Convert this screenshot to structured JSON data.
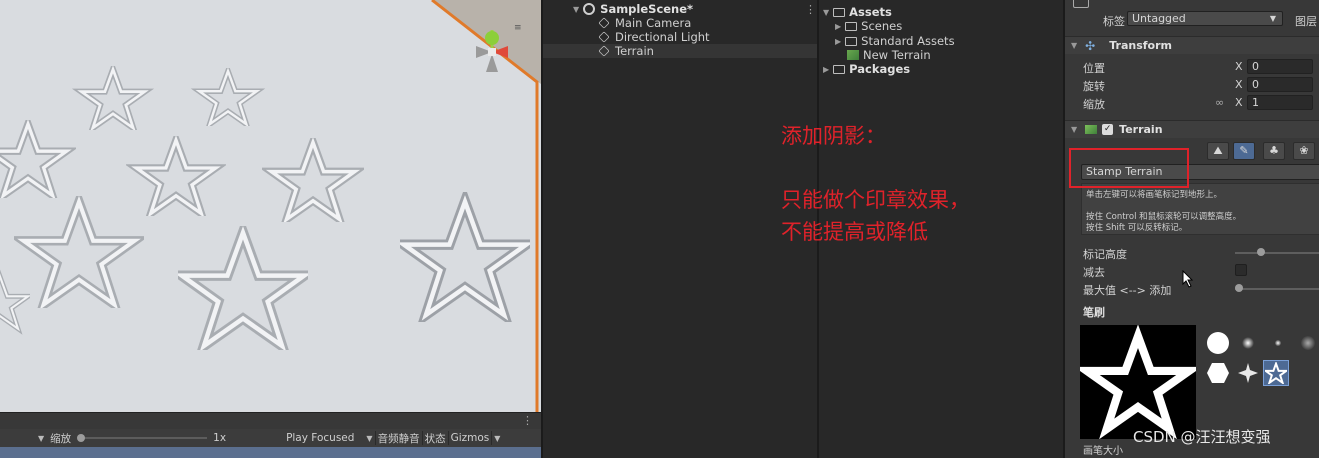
{
  "hierarchy": {
    "scene_name": "SampleScene*",
    "items": [
      {
        "label": "Main Camera"
      },
      {
        "label": "Directional Light"
      },
      {
        "label": "Terrain"
      }
    ]
  },
  "project": {
    "items": [
      {
        "label": "Assets"
      },
      {
        "label": "Scenes"
      },
      {
        "label": "Standard Assets"
      },
      {
        "label": "New Terrain"
      },
      {
        "label": "Packages"
      }
    ]
  },
  "scene_toolbar": {
    "zoom_label": "缩放",
    "zoom_value": "1x",
    "play_focused": "Play Focused",
    "mute_audio": "音频静音",
    "stats": "状态",
    "gizmos": "Gizmos"
  },
  "annotation": {
    "line1": "添加阴影：",
    "line2": "只能做个印章效果，",
    "line3": "不能提高或降低"
  },
  "inspector": {
    "tag_label": "标签",
    "tag_value": "Untagged",
    "layer_label": "图层",
    "transform": {
      "title": "Transform",
      "position_label": "位置",
      "rotation_label": "旋转",
      "scale_label": "缩放",
      "axis_x": "X",
      "position_x": "0",
      "rotation_x": "0",
      "scale_x": "1"
    },
    "terrain": {
      "title": "Terrain",
      "mode_value": "Stamp Terrain",
      "help_line1": "单击左键可以将画笔标记到地形上。",
      "help_line2": "按住 Control 和鼠标滚轮可以调整高度。",
      "help_line3": "按住 Shift 可以反转标记。",
      "stamp_height_label": "标记高度",
      "stamp_height_value": 0.28,
      "subtract_label": "减去",
      "max_add_label": "最大值 <--> 添加",
      "max_add_value": 0.0,
      "brushes_label": "笔刷",
      "brush_size_label": "画笔大小"
    }
  },
  "watermark": "CSDN @汪汪想变强",
  "colors": {
    "annotation_red": "#e0222a",
    "selection_blue": "#4d6a94",
    "terrain_edge_orange": "#e07a2a"
  }
}
